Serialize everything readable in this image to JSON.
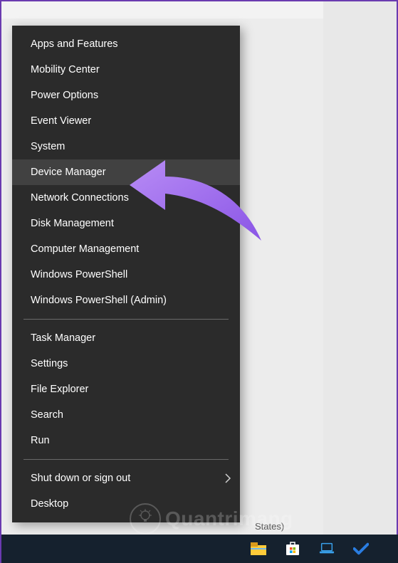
{
  "menu": {
    "group1": [
      {
        "label": "Apps and Features",
        "name": "menu-apps-and-features"
      },
      {
        "label": "Mobility Center",
        "name": "menu-mobility-center"
      },
      {
        "label": "Power Options",
        "name": "menu-power-options"
      },
      {
        "label": "Event Viewer",
        "name": "menu-event-viewer"
      },
      {
        "label": "System",
        "name": "menu-system"
      },
      {
        "label": "Device Manager",
        "name": "menu-device-manager",
        "hover": true
      },
      {
        "label": "Network Connections",
        "name": "menu-network-connections"
      },
      {
        "label": "Disk Management",
        "name": "menu-disk-management"
      },
      {
        "label": "Computer Management",
        "name": "menu-computer-management"
      },
      {
        "label": "Windows PowerShell",
        "name": "menu-windows-powershell"
      },
      {
        "label": "Windows PowerShell (Admin)",
        "name": "menu-windows-powershell-admin"
      }
    ],
    "group2": [
      {
        "label": "Task Manager",
        "name": "menu-task-manager"
      },
      {
        "label": "Settings",
        "name": "menu-settings"
      },
      {
        "label": "File Explorer",
        "name": "menu-file-explorer"
      },
      {
        "label": "Search",
        "name": "menu-search"
      },
      {
        "label": "Run",
        "name": "menu-run"
      }
    ],
    "group3": [
      {
        "label": "Shut down or sign out",
        "name": "menu-shutdown-signout",
        "submenu": true
      },
      {
        "label": "Desktop",
        "name": "menu-desktop"
      }
    ]
  },
  "background": {
    "partial_text": "States)"
  },
  "highlight_arrow": {
    "target": "menu-device-manager",
    "color": "#a874f0"
  },
  "watermark": {
    "text": "Quantrimang"
  }
}
